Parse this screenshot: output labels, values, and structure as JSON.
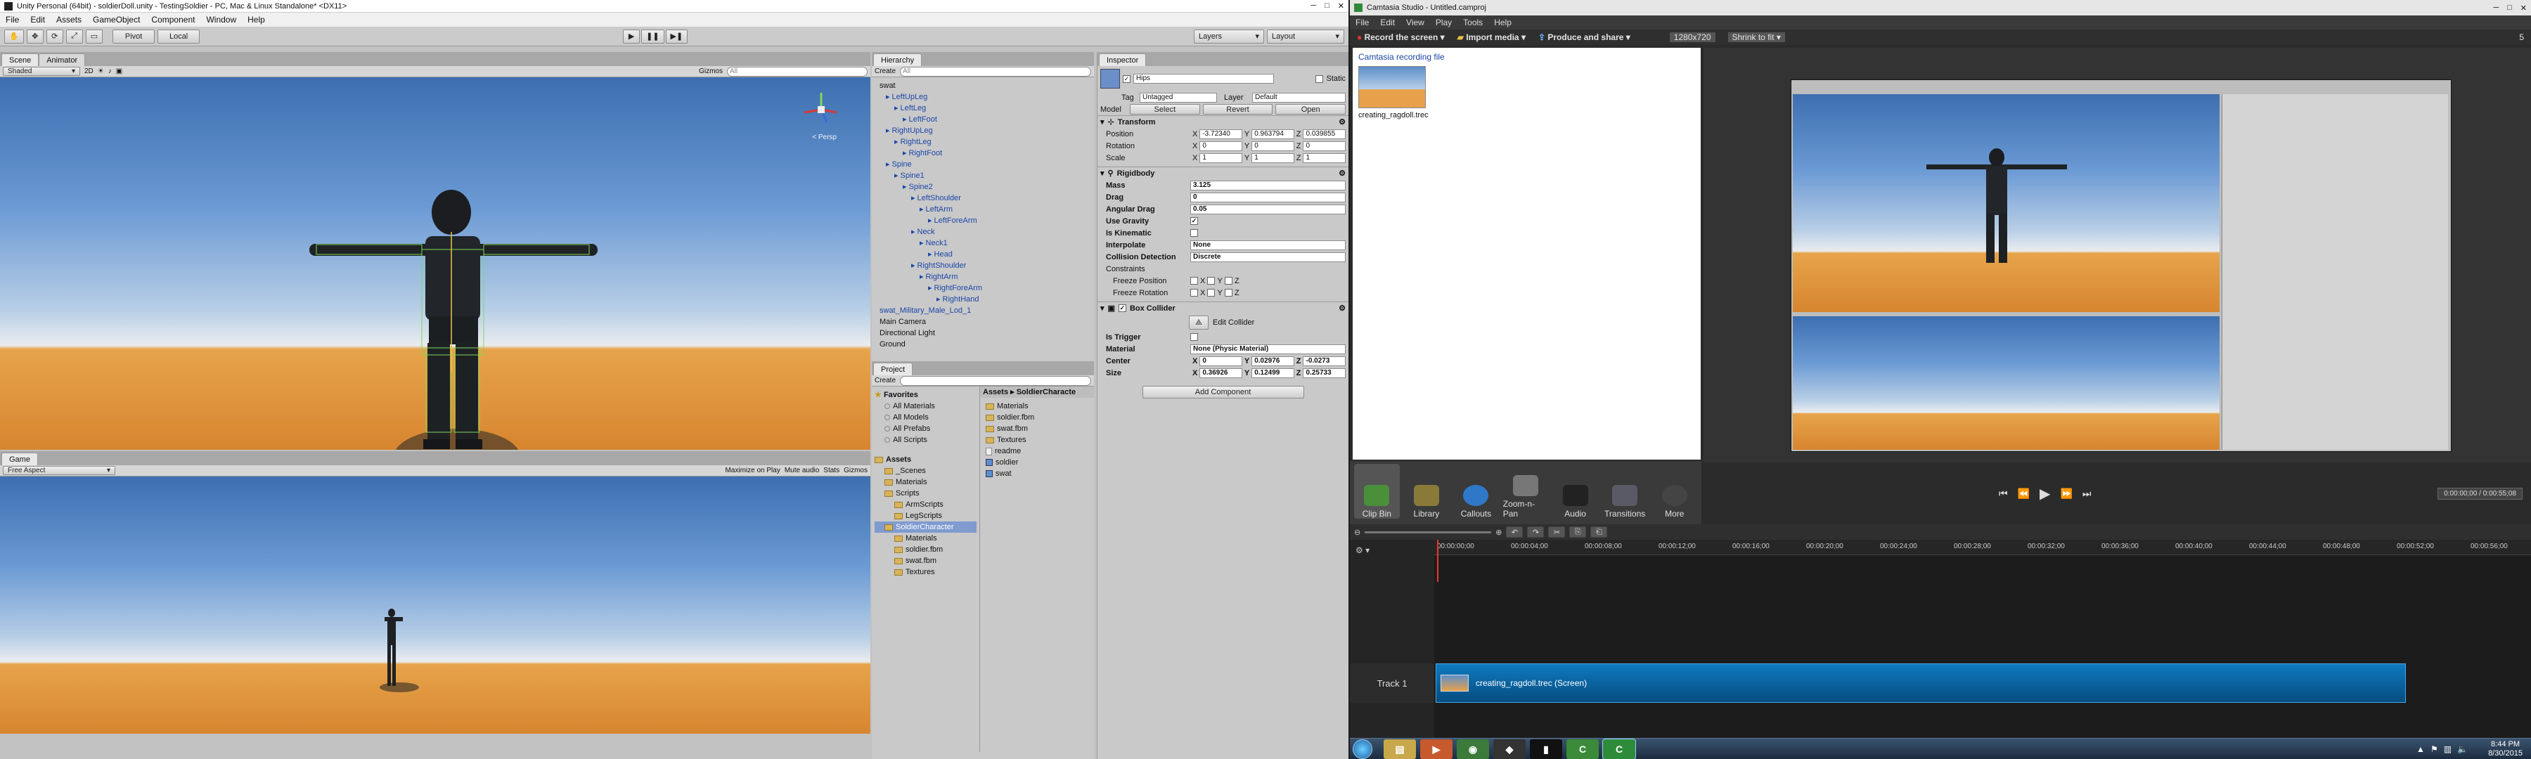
{
  "unity": {
    "title": "Unity Personal (64bit) - soldierDoll.unity - TestingSoldier - PC, Mac & Linux Standalone* <DX11>",
    "menu": [
      "File",
      "Edit",
      "Assets",
      "GameObject",
      "Component",
      "Window",
      "Help"
    ],
    "toolbar": {
      "pivot": "Pivot",
      "local": "Local",
      "layers": "Layers",
      "layout": "Layout"
    },
    "scene": {
      "tab_scene": "Scene",
      "tab_animator": "Animator",
      "shading": "Shaded",
      "mode_2d": "2D",
      "gizmos": "Gizmos",
      "search_placeholder": "All",
      "persp": "< Persp"
    },
    "game": {
      "tab": "Game",
      "aspect": "Free Aspect",
      "maximize": "Maximize on Play",
      "mute": "Mute audio",
      "stats": "Stats",
      "gizmos": "Gizmos"
    },
    "hierarchy": {
      "tab": "Hierarchy",
      "create": "Create",
      "search_placeholder": "All",
      "items": [
        {
          "label": "swat",
          "indent": 0,
          "dark": true
        },
        {
          "label": "LeftUpLeg",
          "indent": 1
        },
        {
          "label": "LeftLeg",
          "indent": 2
        },
        {
          "label": "LeftFoot",
          "indent": 3
        },
        {
          "label": "RightUpLeg",
          "indent": 1
        },
        {
          "label": "RightLeg",
          "indent": 2
        },
        {
          "label": "RightFoot",
          "indent": 3
        },
        {
          "label": "Spine",
          "indent": 1
        },
        {
          "label": "Spine1",
          "indent": 2
        },
        {
          "label": "Spine2",
          "indent": 3
        },
        {
          "label": "LeftShoulder",
          "indent": 4
        },
        {
          "label": "LeftArm",
          "indent": 5
        },
        {
          "label": "LeftForeArm",
          "indent": 6
        },
        {
          "label": "Neck",
          "indent": 4
        },
        {
          "label": "Neck1",
          "indent": 5
        },
        {
          "label": "Head",
          "indent": 6
        },
        {
          "label": "RightShoulder",
          "indent": 4
        },
        {
          "label": "RightArm",
          "indent": 5
        },
        {
          "label": "RightForeArm",
          "indent": 6
        },
        {
          "label": "RightHand",
          "indent": 7
        },
        {
          "label": "swat_Military_Male_Lod_1",
          "indent": 0
        },
        {
          "label": "Main Camera",
          "indent": 0,
          "dark": true
        },
        {
          "label": "Directional Light",
          "indent": 0,
          "dark": true
        },
        {
          "label": "Ground",
          "indent": 0,
          "dark": true
        }
      ]
    },
    "project": {
      "tab": "Project",
      "create": "Create",
      "favorites_label": "Favorites",
      "favorites": [
        "All Materials",
        "All Models",
        "All Prefabs",
        "All Scripts"
      ],
      "assets_label": "Assets",
      "tree": [
        {
          "label": "_Scenes",
          "indent": 1
        },
        {
          "label": "Materials",
          "indent": 1
        },
        {
          "label": "Scripts",
          "indent": 1
        },
        {
          "label": "ArmScripts",
          "indent": 2
        },
        {
          "label": "LegScripts",
          "indent": 2
        },
        {
          "label": "SoldierCharacter",
          "indent": 1,
          "selected": true
        },
        {
          "label": "Materials",
          "indent": 2
        },
        {
          "label": "soldier.fbm",
          "indent": 2
        },
        {
          "label": "swat.fbm",
          "indent": 2
        },
        {
          "label": "Textures",
          "indent": 2
        }
      ],
      "breadcrumb": "Assets ▸ SoldierCharacte",
      "files": [
        {
          "label": "Materials",
          "type": "folder"
        },
        {
          "label": "soldier.fbm",
          "type": "folder"
        },
        {
          "label": "swat.fbm",
          "type": "folder"
        },
        {
          "label": "Textures",
          "type": "folder"
        },
        {
          "label": "readme",
          "type": "file"
        },
        {
          "label": "soldier",
          "type": "model"
        },
        {
          "label": "swat",
          "type": "model"
        }
      ]
    },
    "inspector": {
      "tab": "Inspector",
      "name": "Hips",
      "static": "Static",
      "tag_label": "Tag",
      "tag": "Untagged",
      "layer_label": "Layer",
      "layer": "Default",
      "model_label": "Model",
      "select": "Select",
      "revert": "Revert",
      "open": "Open",
      "transform": {
        "title": "Transform",
        "position": {
          "label": "Position",
          "x": "-3.72340",
          "y": "0.963794",
          "z": "0.039855"
        },
        "rotation": {
          "label": "Rotation",
          "x": "0",
          "y": "0",
          "z": "0"
        },
        "scale": {
          "label": "Scale",
          "x": "1",
          "y": "1",
          "z": "1"
        }
      },
      "rigidbody": {
        "title": "Rigidbody",
        "mass_label": "Mass",
        "mass": "3.125",
        "drag_label": "Drag",
        "drag": "0",
        "angular_label": "Angular Drag",
        "angular": "0.05",
        "gravity_label": "Use Gravity",
        "kinematic_label": "Is Kinematic",
        "interpolate_label": "Interpolate",
        "interpolate": "None",
        "collision_label": "Collision Detection",
        "collision": "Discrete",
        "constraints_label": "Constraints",
        "freeze_pos_label": "Freeze Position",
        "freeze_rot_label": "Freeze Rotation"
      },
      "box": {
        "title": "Box Collider",
        "edit": "Edit Collider",
        "trigger_label": "Is Trigger",
        "material_label": "Material",
        "material": "None (Physic Material)",
        "center_label": "Center",
        "cx": "0",
        "cy": "0.02976",
        "cz": "-0.0273",
        "size_label": "Size",
        "sx": "0.36926",
        "sy": "0.12499",
        "sz": "0.25733"
      },
      "add_component": "Add Component"
    }
  },
  "camtasia": {
    "title": "Camtasia Studio - Untitled.camproj",
    "menu": [
      "File",
      "Edit",
      "View",
      "Play",
      "Tools",
      "Help"
    ],
    "record": "Record the screen",
    "import": "Import media",
    "produce": "Produce and share",
    "resolution": "1280x720",
    "shrink": "Shrink to fit",
    "status_num": "5",
    "clip_bin_header": "Camtasia recording file",
    "clip_name": "creating_ragdoll.trec",
    "ribbon": [
      "Clip Bin",
      "Library",
      "Callouts",
      "Zoom-n-Pan",
      "Audio",
      "Transitions",
      "More"
    ],
    "time": "0:00:00;00 / 0:00:55;08",
    "ticks": [
      "00:00:00;00",
      "00:00:04;00",
      "00:00:08;00",
      "00:00:12;00",
      "00:00:16;00",
      "00:00:20;00",
      "00:00:24;00",
      "00:00:28;00",
      "00:00:32;00",
      "00:00:36;00",
      "00:00:40;00",
      "00:00:44;00",
      "00:00:48;00",
      "00:00:52;00",
      "00:00:56;00"
    ],
    "track_label": "Track 1",
    "track_clip": "creating_ragdoll.trec (Screen)"
  },
  "taskbar": {
    "time": "8:44 PM",
    "date": "8/30/2015"
  },
  "colors": {
    "hier_blue": "#1a46a8",
    "cam_accent": "#0a6aa0"
  }
}
